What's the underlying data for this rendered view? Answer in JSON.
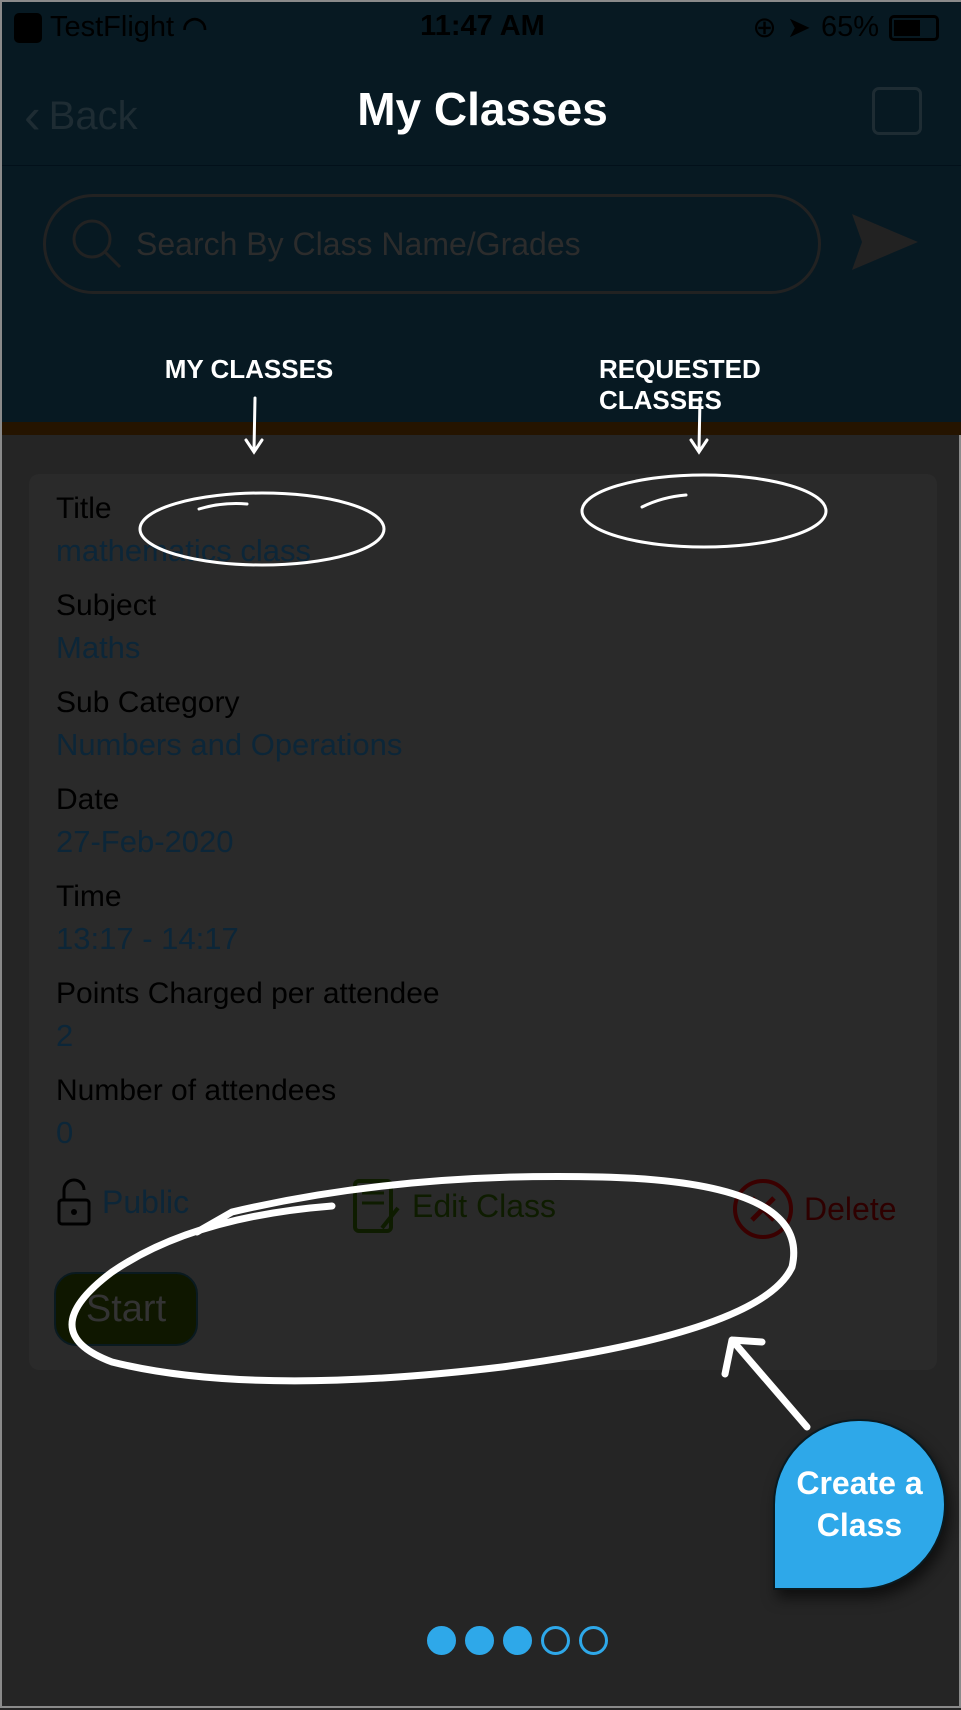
{
  "status_bar": {
    "app": "TestFlight",
    "time": "11:47 AM",
    "battery": "65%"
  },
  "nav": {
    "back_label": "Back",
    "title": "My Classes"
  },
  "search": {
    "placeholder": "Search By Class Name/Grades",
    "value": ""
  },
  "annotations": {
    "my_classes": "MY CLASSES",
    "requested_classes": "REQUESTED CLASSES",
    "create_class_line1": "Create a",
    "create_class_line2": "Class"
  },
  "card": {
    "fields": [
      {
        "label": "Title",
        "value": "mathematics class"
      },
      {
        "label": "Subject",
        "value": "Maths"
      },
      {
        "label": "Sub Category",
        "value": "Numbers and Operations"
      },
      {
        "label": "Date",
        "value": "27-Feb-2020"
      },
      {
        "label": "Time",
        "value": "13:17 - 14:17"
      },
      {
        "label": "Points Charged per attendee",
        "value": "2"
      },
      {
        "label": "Number of attendees",
        "value": "0"
      }
    ],
    "visibility": "Public",
    "edit_label": "Edit Class",
    "delete_label": "Delete",
    "start_label": "Start"
  },
  "pager": {
    "total": 5,
    "active": 3
  },
  "colors": {
    "accent": "#2ea8e9",
    "header": "#071922",
    "background": "#252525"
  }
}
